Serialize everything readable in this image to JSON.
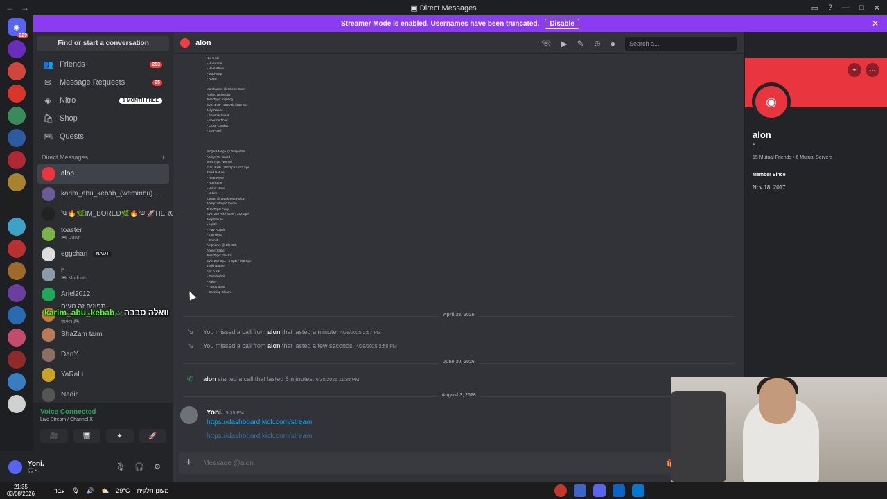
{
  "window": {
    "title": "Direct Messages"
  },
  "banner": {
    "text": "Streamer Mode is enabled. Usernames have been truncated.",
    "button": "Disable"
  },
  "servers": {
    "home_badge": "229",
    "colors": [
      "#5865f2",
      "#6a2cbb",
      "#d1463c",
      "#d9352b",
      "#3a8a5c",
      "#2d5aa0",
      "#b02833",
      "#a8832e",
      "#1f1f1f",
      "#3fa0c8",
      "#ba3030",
      "#9e6a2c",
      "#6b3fa0",
      "#2a6ab0",
      "#c44b6b",
      "#8f2a2a",
      "#3b7bbf",
      "#d0d0d0"
    ]
  },
  "sidebar": {
    "search_label": "Find or start a conversation",
    "nav": [
      {
        "label": "Friends",
        "count": "203",
        "icon": "friends-icon"
      },
      {
        "label": "Message Requests",
        "count": "25",
        "icon": "inbox-icon"
      },
      {
        "label": "Nitro",
        "pill": "1 MONTH FREE",
        "icon": "nitro-icon"
      },
      {
        "label": "Shop",
        "icon": "shop-icon"
      },
      {
        "label": "Quests",
        "icon": "quests-icon"
      }
    ],
    "dm_header": "Direct Messages",
    "dms": [
      {
        "name": "alon",
        "sub": "",
        "color": "#e8353e"
      },
      {
        "name": "karim_abu_kebab_(wemmbu) ...",
        "sub": "",
        "color": "#6b5b95"
      },
      {
        "name": "༄🔥🌿IM_BORED🌿🔥༄ 🚀HERO",
        "sub": "",
        "color": "#222"
      },
      {
        "name": "toaster",
        "sub": "🎮 Dawn",
        "color": "#7bb34a"
      },
      {
        "name": "eggchan",
        "sub": "",
        "tag": "NAUT",
        "color": "#dddddd"
      },
      {
        "name": "h...",
        "sub": "🎮 Modrinth",
        "color": "#8a9aa8"
      },
      {
        "name": "Ariel2012",
        "sub": "",
        "color": "#23a55a"
      },
      {
        "name": "תפוזים זה טעים",
        "sub": "לי דלושן זה הסדרה הכי גרועה שאני ראיתי 🎮",
        "tag": "PRIME",
        "color": "#c47d3a"
      },
      {
        "name": "ShaZam taim",
        "sub": "",
        "color": "#b97a5b"
      },
      {
        "name": "DanY",
        "sub": "",
        "color": "#8d6e63"
      },
      {
        "name": "YaRaLi",
        "sub": "",
        "color": "#c9a227"
      },
      {
        "name": "Nadir",
        "sub": "",
        "color": "#555"
      }
    ]
  },
  "voice": {
    "title": "Voice Connected",
    "channel": "Live Stream / Channel X",
    "buttons": [
      "🎥",
      "🖥",
      "✦",
      "🚀"
    ]
  },
  "user": {
    "name": "Yoni.",
    "status": "🎧 • ."
  },
  "chat": {
    "title": "alon",
    "search_placeholder": "Search a...",
    "image_text": [
      "Nu: 0 Atk",
      "• Hurricane",
      "• Heat Wave",
      "• Mud-Slap",
      "• Roost",
      "",
      "Marshadow @ Choice Scarf",
      "Ability: Technician",
      "Tera Type: Fighting",
      "EVs: 4 HP / 252 Atk / 252 Spe",
      "Jolly Nature",
      "• Shadow Sneak",
      "• Spectral Thief",
      "• Close Combat",
      "• Ice Punch",
      "",
      "",
      "",
      "Pidgeot-Mega @ Pidgeotite",
      "Ability: No Guard",
      "Tera Type: Normal",
      "EVs: 4 HP / 252 SpA / 252 Spe",
      "Timid Nature",
      "• Heat Wave",
      "• Hurricane",
      "• Mirror Move",
      "• U-turn",
      "Zacian @ Weakness Policy",
      "Ability: Intrepid Sword",
      "Tera Type: Fairy",
      "EVs: 252 Atk / 4 Def / 252 Spe",
      "Jolly Nature",
      "• Agility",
      "• Play Rough",
      "• Iron Head",
      "• Crunch",
      "Ampharos @ Life Orb",
      "Ability: Static",
      "Tera Type: Electric",
      "EVs: 252 SpA / 4 SpD / 252 Spe",
      "Timid Nature",
      "IVs: 0 Atk",
      "• Thunderbolt",
      "• Agility",
      "• Focus Blast",
      "• Dazzling Gleam"
    ],
    "date1": "April 28, 2025",
    "missed1": {
      "pre": "You missed a call from",
      "who": "alon",
      "post": "that lasted a minute.",
      "ts": "4/28/2025 2:57 PM"
    },
    "missed2": {
      "pre": "You missed a call from",
      "who": "alon",
      "post": "that lasted a few seconds.",
      "ts": "4/28/2025 2:58 PM"
    },
    "date2": "June 30, 2026",
    "call": {
      "who": "alon",
      "post": "started a call that lasted 6 minutes.",
      "ts": "6/30/2026 11:38 PM"
    },
    "date3": "August 3, 2026",
    "message": {
      "author": "Yoni.",
      "time": "9:35 PM",
      "link1": "https://dashboard.kick.com/stream",
      "link2": "https://dashboard.kick.com/stream"
    },
    "composer_placeholder": "Message @alon"
  },
  "profile": {
    "name": "alon",
    "sub": "a...",
    "mutual": "15 Mutual Friends • 6 Mutual Servers",
    "member_since_label": "Member Since",
    "member_since": "Nov 18, 2017",
    "banner_color": "#e8353e"
  },
  "overlay": {
    "left": "karim_abu_kebab :",
    "right": "וואלה סבבה"
  },
  "taskbar": {
    "time": "21:35",
    "date": "03/08/2026",
    "lang": "עבר",
    "weather": "29°C",
    "weather_text": "מעונן חלקית"
  }
}
